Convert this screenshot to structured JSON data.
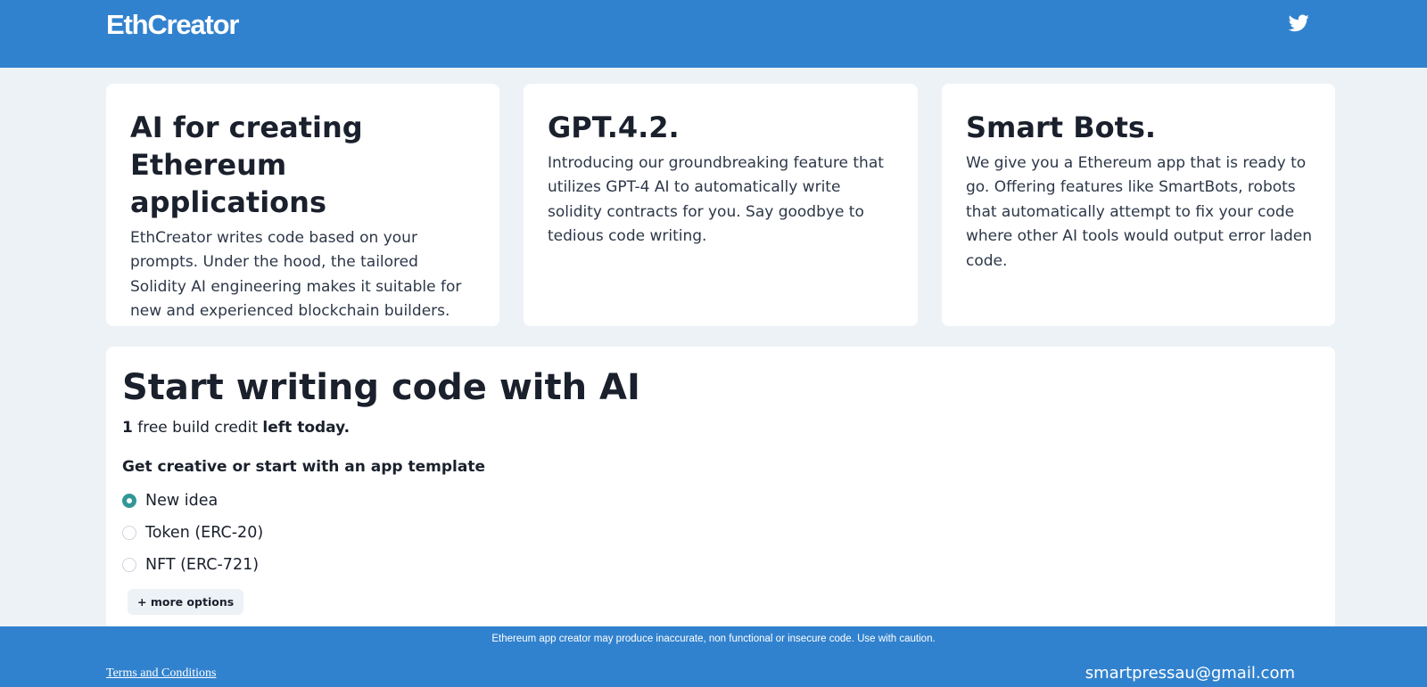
{
  "header": {
    "logo": "EthCreator",
    "twitter_icon": "twitter-icon"
  },
  "features": [
    {
      "title": "AI for creating Ethereum applications",
      "text": "EthCreator writes code based on your prompts. Under the hood, the tailored Solidity AI engineering makes it suitable for new and experienced blockchain builders."
    },
    {
      "title": "GPT.4.2.",
      "text": "Introducing our groundbreaking feature that utilizes GPT-4 AI to automatically write solidity contracts for you. Say goodbye to tedious code writing."
    },
    {
      "title": "Smart Bots.",
      "text": "We give you a Ethereum app that is ready to go. Offering features like SmartBots, robots that automatically attempt to fix your code where other AI tools would output error laden code."
    }
  ],
  "main": {
    "title": "Start writing code with AI",
    "credit_count": "1",
    "credit_middle": "free build credit",
    "credit_suffix": "left today.",
    "template_label": "Get creative or start with an app template",
    "options": [
      {
        "label": "New idea",
        "selected": true
      },
      {
        "label": "Token (ERC-20)",
        "selected": false
      },
      {
        "label": "NFT (ERC-721)",
        "selected": false
      }
    ],
    "more_options": "+ more options"
  },
  "footer": {
    "disclaimer": "Ethereum app creator may produce inaccurate, non functional or insecure code. Use with caution.",
    "terms": "Terms and Conditions",
    "email": "smartpressau@gmail.com"
  },
  "colors": {
    "primary": "#3182ce",
    "background": "#edf2f7",
    "radio_selected": "#319795"
  }
}
